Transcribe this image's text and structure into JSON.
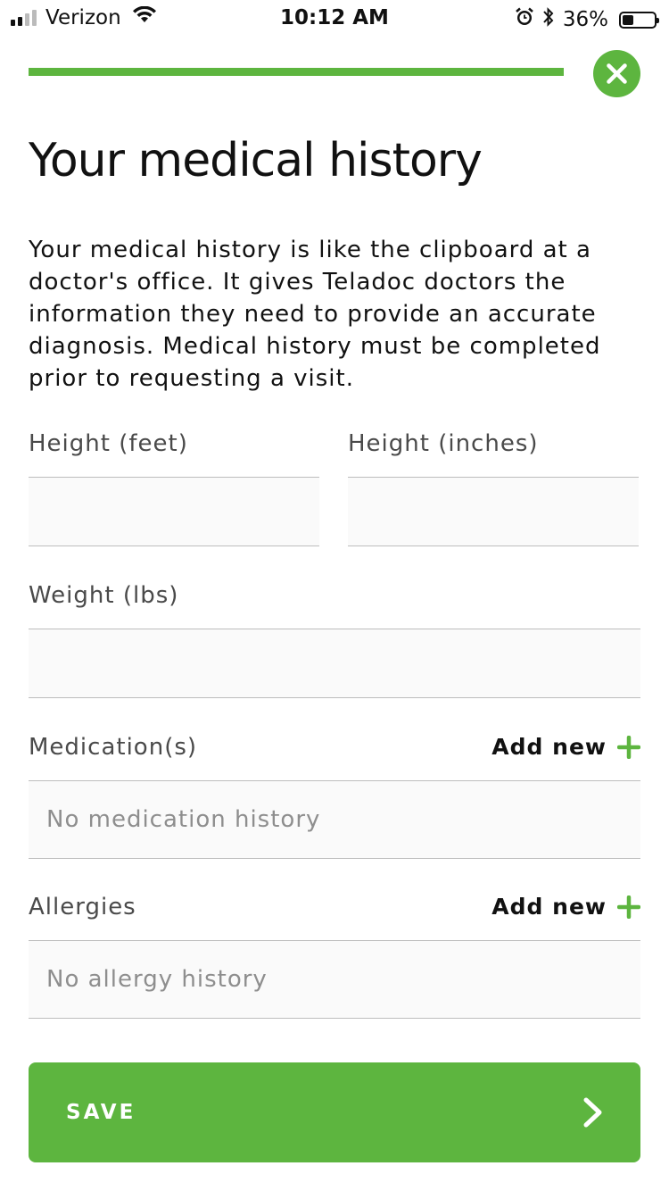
{
  "status_bar": {
    "carrier": "Verizon",
    "time": "10:12 AM",
    "battery_percent": "36%",
    "battery_level": 0.36,
    "icons": [
      "signal-icon",
      "wifi-icon",
      "alarm-icon",
      "bluetooth-icon",
      "battery-icon"
    ]
  },
  "progress": {
    "value": 1.0,
    "color": "#5db53f"
  },
  "page": {
    "title": "Your medical history",
    "intro": "Your medical history is like the clipboard at a doctor's office. It gives Teladoc doctors the information they need to provide an accurate diagnosis. Medical history must be completed prior to requesting a visit."
  },
  "form": {
    "height_feet": {
      "label": "Height (feet)",
      "value": ""
    },
    "height_inches": {
      "label": "Height (inches)",
      "value": ""
    },
    "weight": {
      "label": "Weight (lbs)",
      "value": ""
    },
    "medications": {
      "label": "Medication(s)",
      "add_label": "Add new",
      "empty_text": "No medication history"
    },
    "allergies": {
      "label": "Allergies",
      "add_label": "Add new",
      "empty_text": "No allergy history"
    }
  },
  "save_button": {
    "label": "SAVE"
  },
  "colors": {
    "accent": "#5db53f",
    "text": "#111111",
    "muted": "#8e8e8e"
  }
}
